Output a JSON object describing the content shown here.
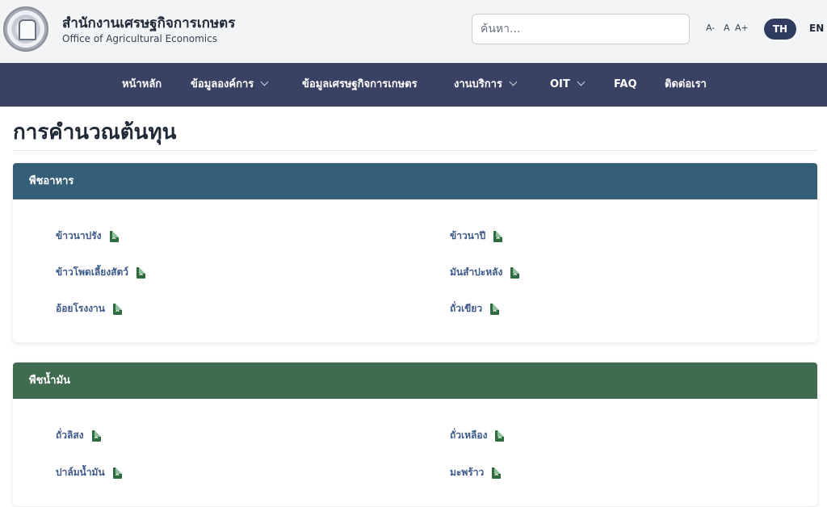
{
  "header": {
    "org_name_th": "สำนักงานเศรษฐกิจการเกษตร",
    "org_name_en": "Office of Agricultural Economics",
    "search_placeholder": "ค้นหา...",
    "font_size": {
      "decrease": "A-",
      "normal": "A",
      "increase": "A+"
    },
    "languages": {
      "th": "TH",
      "en": "EN",
      "selected": "TH"
    },
    "colors": {
      "nav_bg": "#3a4264",
      "lang_active_bg": "#2f3b61"
    }
  },
  "nav": {
    "items": [
      {
        "label": "หน้าหลัก",
        "dropdown": false
      },
      {
        "label": "ข้อมูลองค์การ",
        "dropdown": true
      },
      {
        "label": "ข้อมูลเศรษฐกิจการเกษตร",
        "dropdown": false
      },
      {
        "label": "งานบริการ",
        "dropdown": true
      },
      {
        "label": "OIT",
        "dropdown": true
      },
      {
        "label": "FAQ",
        "dropdown": false
      },
      {
        "label": "ติดต่อเรา",
        "dropdown": false
      }
    ]
  },
  "page": {
    "title": "การคำนวณต้นทุน"
  },
  "sections": [
    {
      "heading": "พืชอาหาร",
      "color": "#355f77",
      "items": [
        {
          "label": "ข้าวนาปรัง",
          "icon": "excel-file-icon"
        },
        {
          "label": "ข้าวนาปี",
          "icon": "excel-file-icon"
        },
        {
          "label": "ข้าวโพดเลี้ยงสัตว์",
          "icon": "excel-file-icon"
        },
        {
          "label": "มันสำปะหลัง",
          "icon": "excel-file-icon"
        },
        {
          "label": "อ้อยโรงงาน",
          "icon": "excel-file-icon"
        },
        {
          "label": "ถั่วเขียว",
          "icon": "excel-file-icon"
        }
      ]
    },
    {
      "heading": "พืชน้ำมัน",
      "color": "#416b4f",
      "items": [
        {
          "label": "ถั่วลิสง",
          "icon": "excel-file-icon"
        },
        {
          "label": "ถั่วเหลือง",
          "icon": "excel-file-icon"
        },
        {
          "label": "ปาล์มน้ำมัน",
          "icon": "excel-file-icon"
        },
        {
          "label": "มะพร้าว",
          "icon": "excel-file-icon"
        }
      ]
    }
  ]
}
